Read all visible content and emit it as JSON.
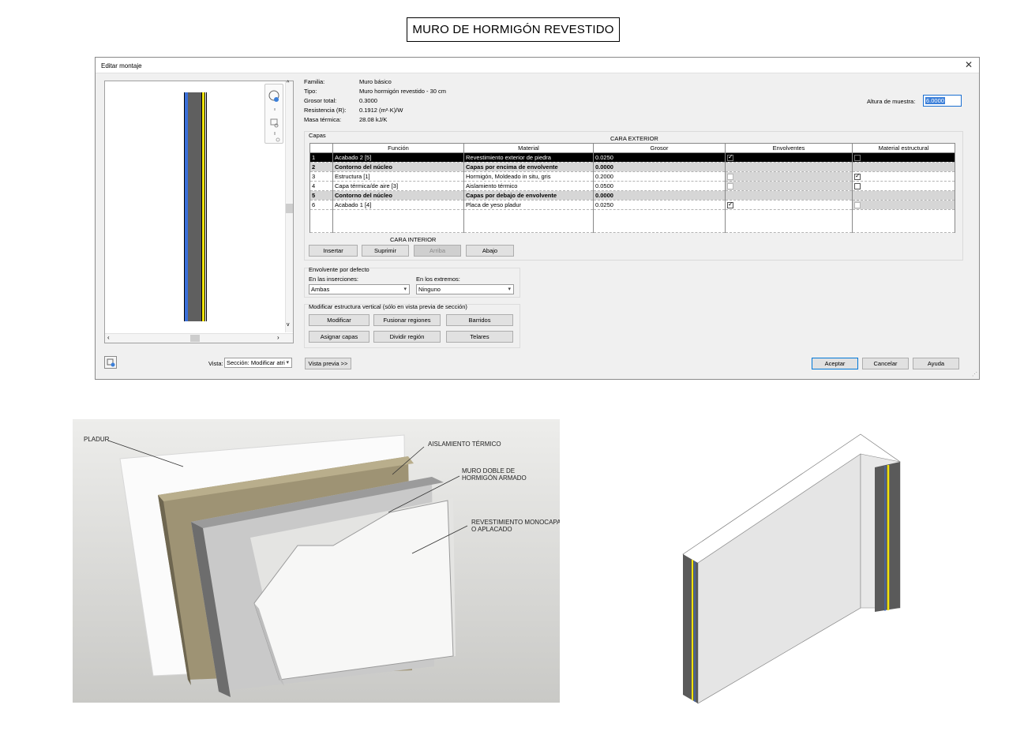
{
  "page_title": "MURO DE HORMIGÓN REVESTIDO",
  "dialog": {
    "title": "Editar montaje",
    "close_icon": "close-icon",
    "properties": [
      {
        "label": "Familia:",
        "value": "Muro básico"
      },
      {
        "label": "Tipo:",
        "value": "Muro hormigón revestido - 30 cm"
      },
      {
        "label": "Grosor total:",
        "value": "0.3000"
      },
      {
        "label": "Resistencia (R):",
        "value": "0.1912 (m²·K)/W"
      },
      {
        "label": "Masa térmica:",
        "value": "28.08 kJ/K"
      }
    ],
    "sample_height_label": "Altura de muestra:",
    "sample_height_value": "6.0000",
    "layers_caption": "Capas",
    "exterior_side": "CARA EXTERIOR",
    "interior_side": "CARA INTERIOR",
    "columns": [
      "Función",
      "Material",
      "Grosor",
      "Envolventes",
      "Material estructural"
    ],
    "layers": [
      {
        "num": "1",
        "function": "Acabado 2 [5]",
        "material": "Revestimiento exterior de piedra",
        "thickness": "0.0250",
        "wrap": true,
        "structural": false,
        "selected": true
      },
      {
        "num": "2",
        "function": "Contorno del núcleo",
        "material": "Capas por encima de envolvente",
        "thickness": "0.0000",
        "core": true
      },
      {
        "num": "3",
        "function": "Estructura [1]",
        "material": "Hormigón, Moldeado in situ, gris",
        "thickness": "0.2000",
        "wrap": false,
        "structural": true
      },
      {
        "num": "4",
        "function": "Capa térmica/de aire [3]",
        "material": "Aislamiento térmico",
        "thickness": "0.0500",
        "wrap": false,
        "structural": false
      },
      {
        "num": "5",
        "function": "Contorno del núcleo",
        "material": "Capas por debajo de envolvente",
        "thickness": "0.0000",
        "core": true
      },
      {
        "num": "6",
        "function": "Acabado 1 [4]",
        "material": "Placa de yeso pladur",
        "thickness": "0.0250",
        "wrap": true,
        "structural": false
      }
    ],
    "layer_buttons": {
      "insert": "Insertar",
      "delete": "Suprimir",
      "up": "Arriba",
      "down": "Abajo"
    },
    "default_wrapping": {
      "title": "Envolvente por defecto",
      "at_inserts_label": "En las inserciones:",
      "at_inserts_value": "Ambas",
      "at_ends_label": "En los extremos:",
      "at_ends_value": "Ninguno"
    },
    "vertical_structure": {
      "title": "Modificar estructura vertical (sólo en vista previa de sección)",
      "modify": "Modificar",
      "merge": "Fusionar regiones",
      "sweeps": "Barridos",
      "assign": "Asignar capas",
      "split": "Dividir región",
      "reveals": "Telares"
    },
    "view_label": "Vista:",
    "view_value": "Sección: Modificar atri",
    "preview_button": "Vista previa >>",
    "ok": "Aceptar",
    "cancel": "Cancelar",
    "help": "Ayuda"
  },
  "illustration": {
    "labels": {
      "pladur": "PLADUR",
      "insulation": "AISLAMIENTO TÉRMICO",
      "wall_line1": "MURO DOBLE DE",
      "wall_line2": "HORMIGÓN ARMADO",
      "coating_line1": "REVESTIMIENTO MONOCAPA",
      "coating_line2": "O APLACADO"
    }
  },
  "colors": {
    "selection": "#000000",
    "core_row": "#d6d6d6",
    "accent": "#0078d7",
    "insulation_yellow": "#f2e30a",
    "pladur_blue": "#3a6fd8",
    "concrete_gray": "#5f5f5f"
  }
}
